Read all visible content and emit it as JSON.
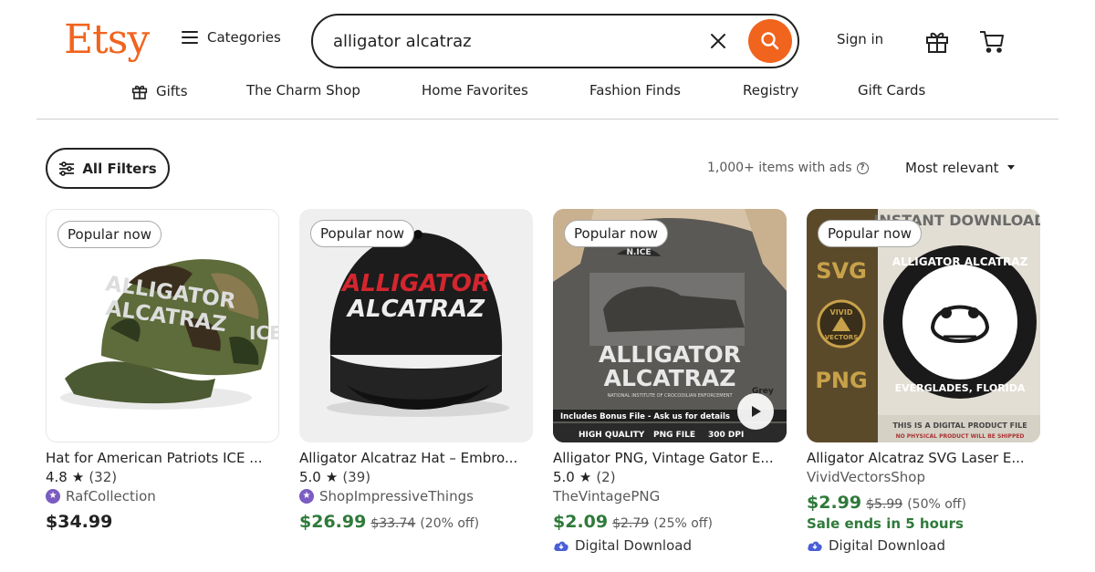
{
  "header": {
    "logo": "Etsy",
    "categories_label": "Categories",
    "search_value": "alligator alcatraz",
    "signin_label": "Sign in"
  },
  "nav": [
    "Gifts",
    "The Charm Shop",
    "Home Favorites",
    "Fashion Finds",
    "Registry",
    "Gift Cards"
  ],
  "toolbar": {
    "filters_label": "All Filters",
    "results_count": "1,000+ items with ads",
    "sort_label": "Most relevant"
  },
  "colors": {
    "accent": "#F1641E",
    "sale_green": "#2F7A3A",
    "star_seller": "#7A5CC2"
  },
  "products": [
    {
      "badge": "Popular now",
      "title": "Hat for American Patriots ICE ...",
      "rating": "4.8",
      "reviews": "(32)",
      "shop": "RafCollection",
      "price": "$34.99",
      "image_text": [
        "ALLIGATOR",
        "ALCATRAZ",
        "ICE"
      ]
    },
    {
      "badge": "Popular now",
      "title": "Alligator Alcatraz Hat – Embro...",
      "rating": "5.0",
      "reviews": "(39)",
      "shop": "ShopImpressiveThings",
      "price": "$26.99",
      "original_price": "$33.74",
      "discount": "(20% off)",
      "image_text": [
        "ALLIGATOR",
        "ALCATRAZ"
      ]
    },
    {
      "badge": "Popular now",
      "title": "Alligator PNG, Vintage Gator E...",
      "rating": "5.0",
      "reviews": "(2)",
      "shop": "TheVintagePNG",
      "price": "$2.09",
      "original_price": "$2.79",
      "discount": "(25% off)",
      "digital": "Digital Download",
      "image_text": [
        "N.ICE",
        "ALLIGATOR",
        "ALCATRAZ",
        "NATIONAL INSTITUTE OF CROCODILIAN ENFORCEMENT",
        "Includes Bonus File - Ask us for details",
        "HIGH QUALITY",
        "PNG FILE",
        "300 DPI",
        "Grey"
      ]
    },
    {
      "badge": "Popular now",
      "title": "Alligator Alcatraz SVG Laser E...",
      "shop": "VividVectorsShop",
      "price": "$2.99",
      "original_price": "$5.99",
      "discount": "(50% off)",
      "sale_ends": "Sale ends in 5 hours",
      "digital": "Digital Download",
      "image_text": [
        "INSTANT DOWNLOAD",
        "SVG",
        "VIVID",
        "VECTORS",
        "PNG",
        "ALLIGATOR ALCATRAZ",
        "EVERGLADES, FLORIDA",
        "THIS IS A DIGITAL PRODUCT FILE",
        "NO PHYSICAL PRODUCT WILL BE SHIPPED"
      ]
    }
  ]
}
